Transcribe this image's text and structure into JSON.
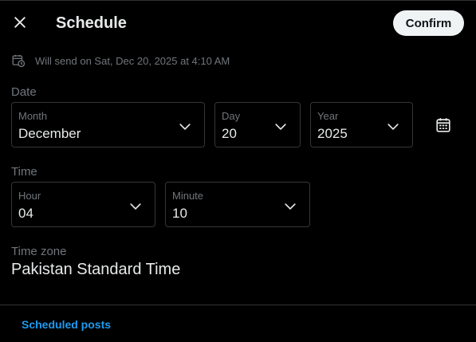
{
  "header": {
    "title": "Schedule",
    "confirm_label": "Confirm"
  },
  "will_send": "Will send on Sat, Dec 20, 2025 at 4:10 AM",
  "date": {
    "section_label": "Date",
    "month": {
      "label": "Month",
      "value": "December"
    },
    "day": {
      "label": "Day",
      "value": "20"
    },
    "year": {
      "label": "Year",
      "value": "2025"
    }
  },
  "time": {
    "section_label": "Time",
    "hour": {
      "label": "Hour",
      "value": "04"
    },
    "minute": {
      "label": "Minute",
      "value": "10"
    }
  },
  "timezone": {
    "label": "Time zone",
    "value": "Pakistan Standard Time"
  },
  "footer": {
    "scheduled_posts_label": "Scheduled posts"
  },
  "icons": {
    "close": "close-icon",
    "will_send": "calendar-clock-icon",
    "chevron": "chevron-down-icon",
    "calendar": "calendar-icon"
  },
  "colors": {
    "background": "#000000",
    "text": "#e7e9ea",
    "muted": "#71767b",
    "border": "#333639",
    "link": "#1d9bf0",
    "confirm_bg": "#eff3f4"
  }
}
